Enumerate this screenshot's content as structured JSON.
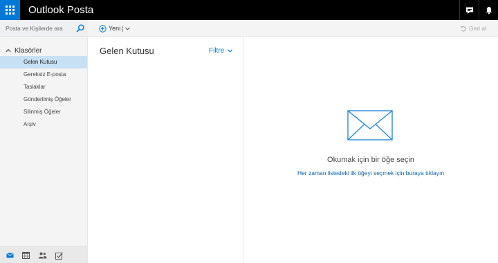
{
  "header": {
    "app_title": "Outlook Posta",
    "icons": [
      "app-launcher-icon",
      "chat-icon",
      "bell-icon"
    ]
  },
  "search": {
    "placeholder": "Posta ve Kişilerde ara"
  },
  "toolbar": {
    "new_label": "Yeni",
    "undo_label": "Geri al"
  },
  "sidebar": {
    "folders_label": "Klasörler",
    "items": [
      {
        "label": "Gelen Kutusu",
        "selected": true
      },
      {
        "label": "Gereksiz E-posta"
      },
      {
        "label": "Taslaklar"
      },
      {
        "label": "Gönderilmiş Öğeler"
      },
      {
        "label": "Silinmiş Öğeler"
      },
      {
        "label": "Arşiv"
      }
    ],
    "bottom_icons": [
      "mail-icon",
      "calendar-icon",
      "people-icon",
      "tasks-icon"
    ]
  },
  "message_list": {
    "title": "Gelen Kutusu",
    "filter_label": "Filtre"
  },
  "reading_pane": {
    "message": "Okumak için bir öğe seçin",
    "link": "Her zaman listedeki ilk öğeyi seçmek için buraya tıklayın"
  },
  "colors": {
    "accent": "#0078d7",
    "topbar": "#000000",
    "selected": "#c7e0f4"
  }
}
